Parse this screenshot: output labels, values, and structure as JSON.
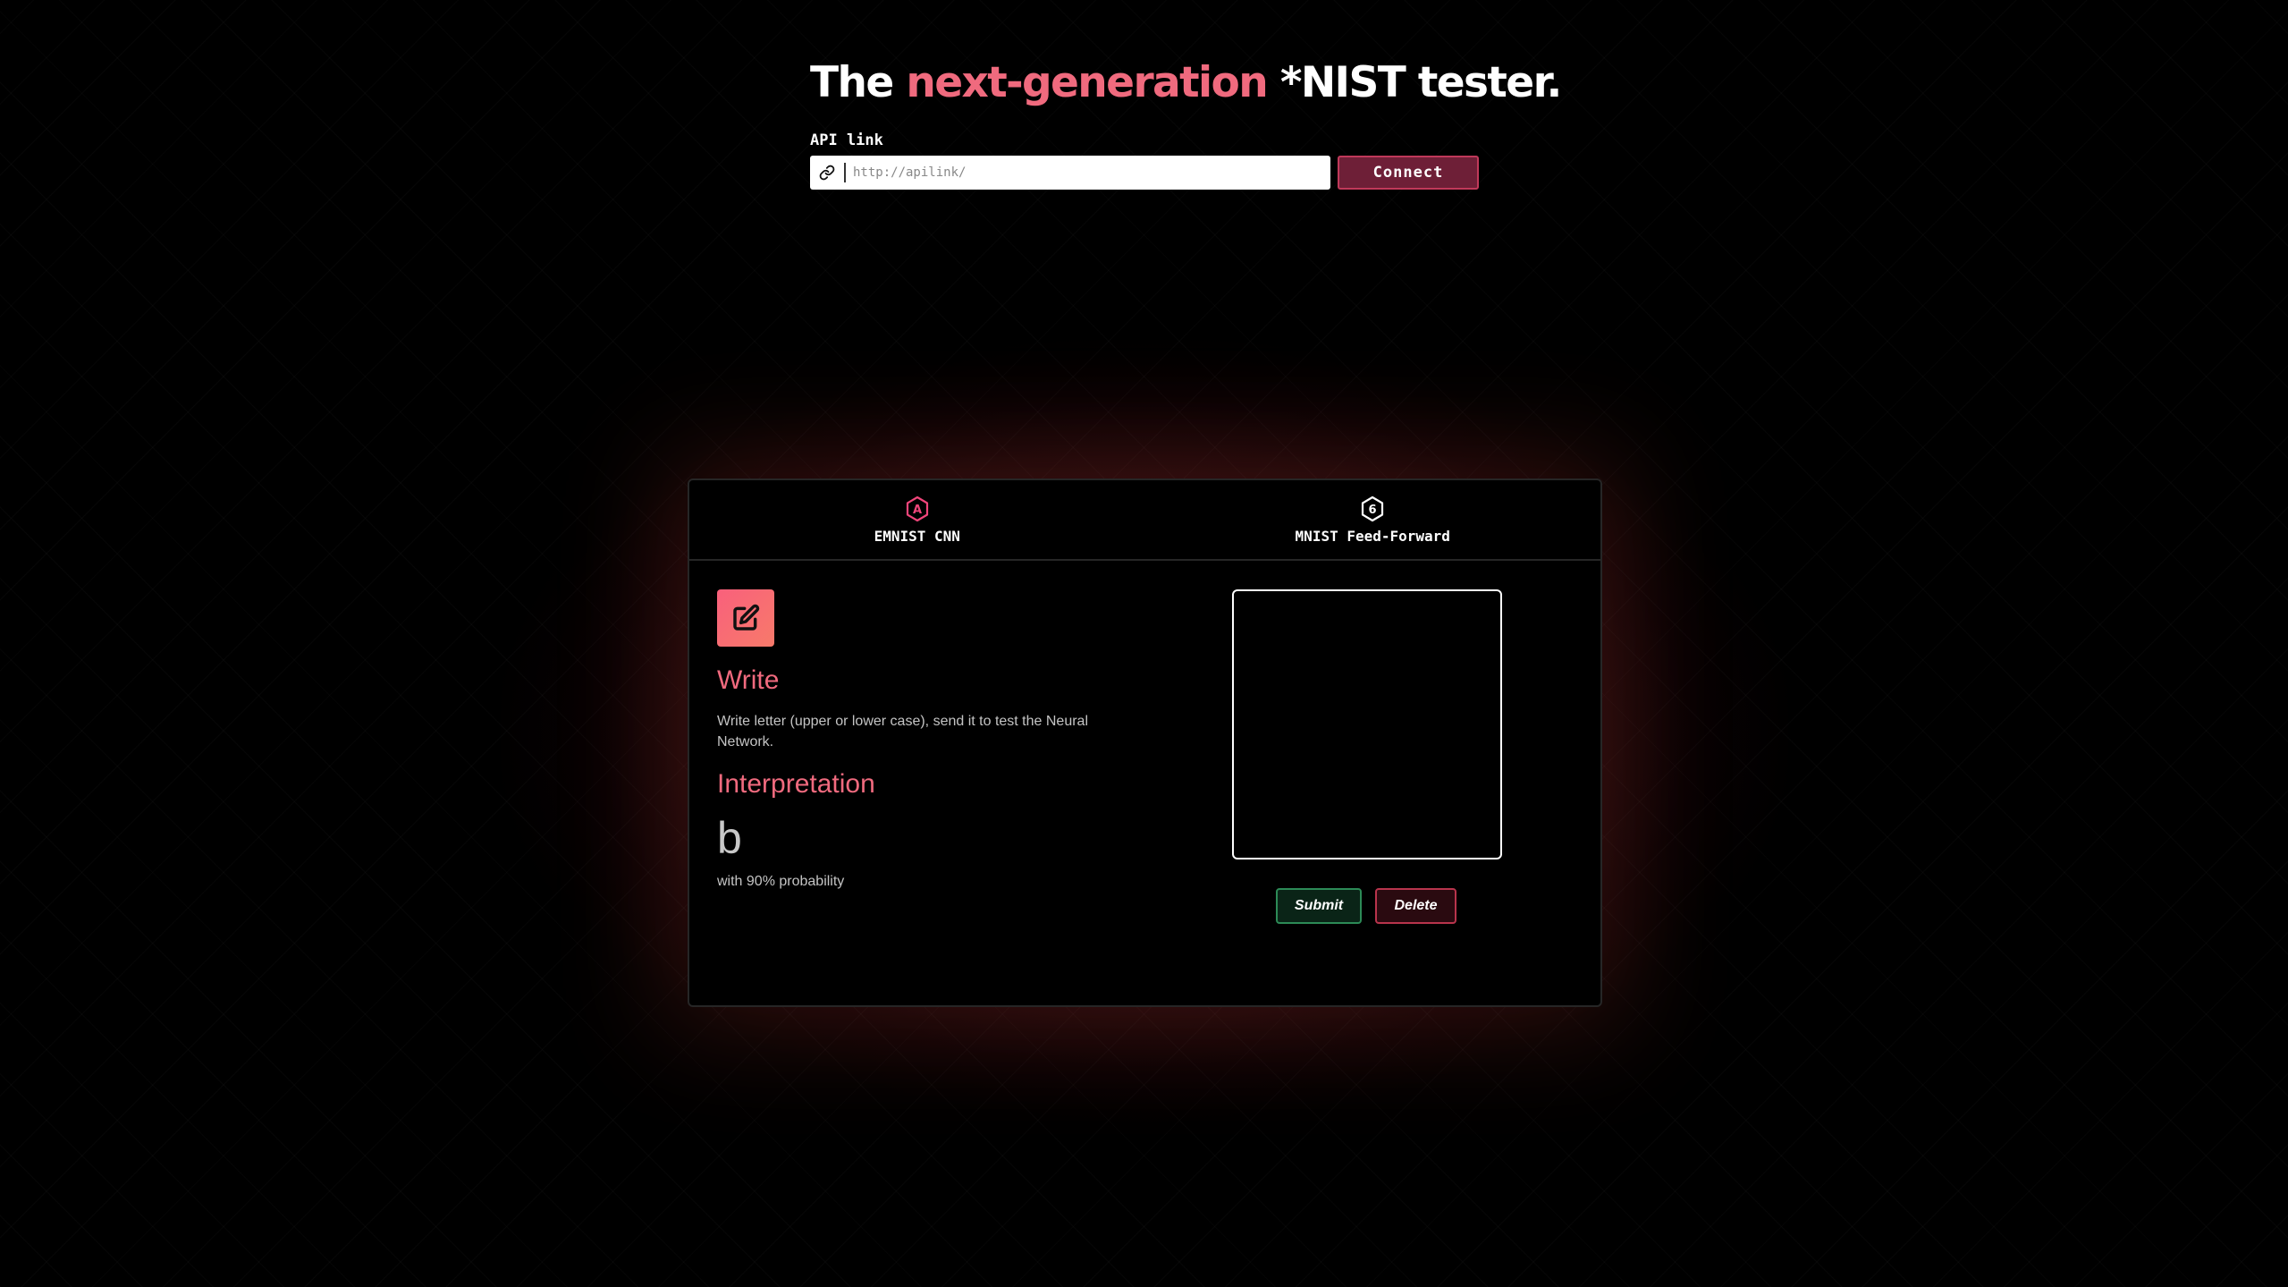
{
  "header": {
    "title_prefix": "The ",
    "title_accent": "next-generation",
    "title_suffix": " *NIST tester.",
    "api_label": "API link",
    "api_placeholder": "http://apilink/",
    "api_value": "",
    "connect_label": "Connect"
  },
  "tabs": [
    {
      "label": "EMNIST CNN",
      "icon": "hexagon-letter-a-icon",
      "icon_glyph": "A",
      "color": "#f0457a"
    },
    {
      "label": "MNIST Feed-Forward",
      "icon": "hexagon-number-6-icon",
      "icon_glyph": "6",
      "color": "#ffffff"
    }
  ],
  "panel": {
    "write_icon": "edit-icon",
    "write_title": "Write",
    "write_description": "Write letter (upper or lower case), send it to test the Neural Network.",
    "interpretation_title": "Interpretation",
    "result": "b",
    "probability_text": "with 90% probability",
    "submit_label": "Submit",
    "delete_label": "Delete"
  },
  "colors": {
    "accent": "#f06a7e",
    "connect_bg": "#6e1f37",
    "submit_border": "#2c8a56",
    "delete_border": "#b8344c"
  }
}
